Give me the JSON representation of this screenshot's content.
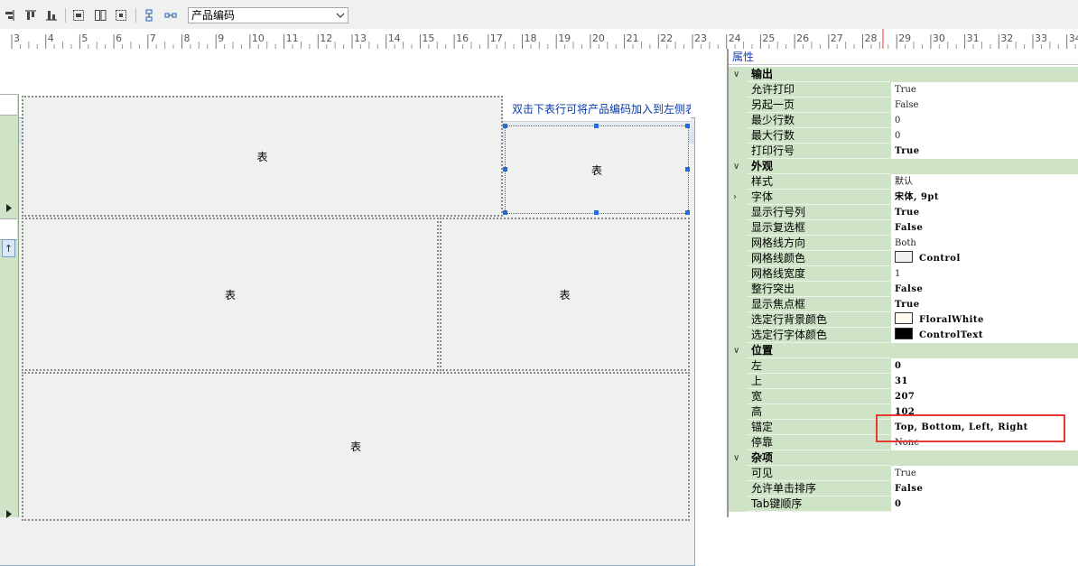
{
  "toolbar": {
    "icons": [
      "align-right-icon",
      "align-top-icon",
      "align-bottom-icon",
      "same-size-icon",
      "same-width-icon",
      "center-icon",
      "vertical-spacing-icon",
      "horizontal-spacing-icon"
    ],
    "combo_value": "产品编码"
  },
  "ruler": {
    "labels": [
      "3",
      "4",
      "5",
      "6",
      "7",
      "8",
      "9",
      "10",
      "11",
      "12",
      "13",
      "14",
      "15",
      "16",
      "17",
      "18",
      "19",
      "20",
      "21",
      "22",
      "23",
      "24",
      "25",
      "26",
      "27",
      "28",
      "29",
      "30",
      "31",
      "32",
      "33",
      "34"
    ]
  },
  "designer": {
    "hint_text": "双击下表行可将产品编码加入到左侧表",
    "panel_label": "表",
    "close_symbol": "✕"
  },
  "properties": {
    "header": "属性",
    "rows": [
      {
        "type": "cat",
        "name": "输出"
      },
      {
        "name": "允许打印",
        "value": "True",
        "bold": false
      },
      {
        "name": "另起一页",
        "value": "False",
        "bold": false
      },
      {
        "name": "最少行数",
        "value": "0",
        "bold": false
      },
      {
        "name": "最大行数",
        "value": "0",
        "bold": false
      },
      {
        "name": "打印行号",
        "value": "True",
        "bold": true
      },
      {
        "type": "cat",
        "name": "外观"
      },
      {
        "name": "样式",
        "value": "默认",
        "bold": false
      },
      {
        "name": "字体",
        "value": "宋体, 9pt",
        "bold": true,
        "expandable": true
      },
      {
        "name": "显示行号列",
        "value": "True",
        "bold": true
      },
      {
        "name": "显示复选框",
        "value": "False",
        "bold": true
      },
      {
        "name": "网格线方向",
        "value": "Both",
        "bold": false
      },
      {
        "name": "网格线颜色",
        "value": "Control",
        "bold": true,
        "swatch": "#f0f0f0"
      },
      {
        "name": "网格线宽度",
        "value": "1",
        "bold": false
      },
      {
        "name": "整行突出",
        "value": "False",
        "bold": true
      },
      {
        "name": "显示焦点框",
        "value": "True",
        "bold": true
      },
      {
        "name": "选定行背景颜色",
        "value": "FloralWhite",
        "bold": true,
        "swatch": "#fffaf0"
      },
      {
        "name": "选定行字体颜色",
        "value": "ControlText",
        "bold": true,
        "swatch": "#000000"
      },
      {
        "type": "cat",
        "name": "位置"
      },
      {
        "name": "左",
        "value": "0",
        "bold": true
      },
      {
        "name": "上",
        "value": "31",
        "bold": true
      },
      {
        "name": "宽",
        "value": "207",
        "bold": true
      },
      {
        "name": "高",
        "value": "102",
        "bold": true
      },
      {
        "name": "锚定",
        "value": "Top, Bottom, Left, Right",
        "bold": true
      },
      {
        "name": "停靠",
        "value": "None",
        "bold": false
      },
      {
        "type": "cat",
        "name": "杂项"
      },
      {
        "name": "可见",
        "value": "True",
        "bold": false
      },
      {
        "name": "允许单击排序",
        "value": "False",
        "bold": true
      },
      {
        "name": "Tab键顺序",
        "value": "0",
        "bold": true
      }
    ]
  },
  "colors": {
    "category_bg": "#cfe4c6",
    "highlight_border": "#e53935",
    "hint_text": "#0a3aa8"
  }
}
